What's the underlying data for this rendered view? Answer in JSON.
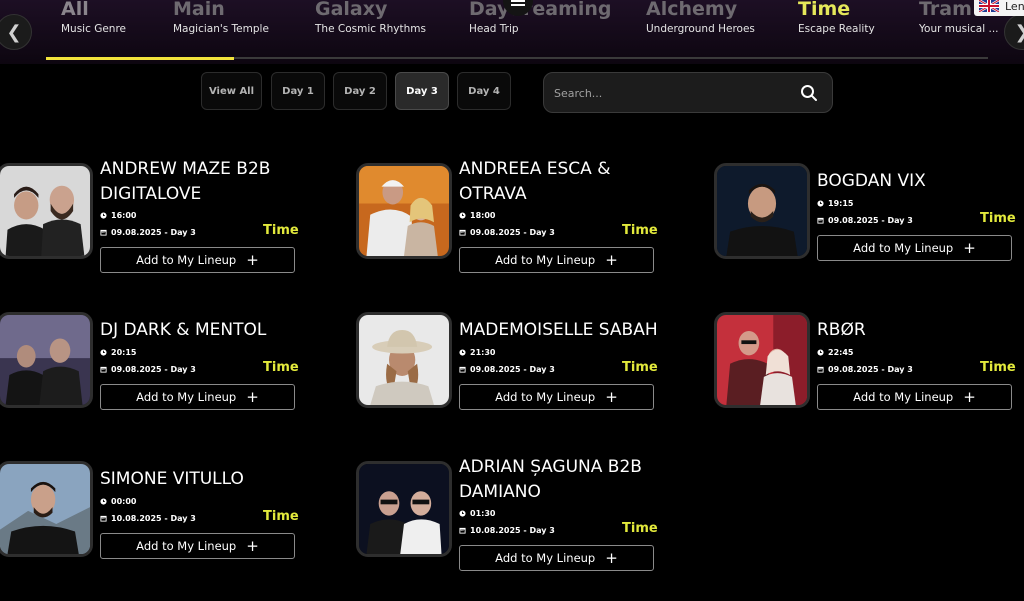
{
  "stages": [
    {
      "name": "All",
      "subtitle": "Music Genre"
    },
    {
      "name": "Main",
      "subtitle": "Magician's Temple"
    },
    {
      "name": "Galaxy",
      "subtitle": "The Cosmic Rhythms"
    },
    {
      "name": "Daydreaming",
      "subtitle": "Head Trip"
    },
    {
      "name": "Alchemy",
      "subtitle": "Underground Heroes"
    },
    {
      "name": "Time",
      "subtitle": "Escape Reality"
    },
    {
      "name": "Tram",
      "subtitle": "Your musical ..."
    }
  ],
  "nav": {
    "prev_icon": "chevron-left-icon",
    "next_icon": "chevron-right-icon",
    "menu_icon": "hamburger-menu-icon"
  },
  "language": {
    "label": "Len",
    "flag_icon": "uk-flag-icon"
  },
  "day_filters": [
    "View All",
    "Day 1",
    "Day 2",
    "Day 3",
    "Day 4"
  ],
  "active_day": "Day 3",
  "search": {
    "placeholder": "Search...",
    "value": "",
    "icon": "magnifier-icon"
  },
  "colors": {
    "accent": "#e3ea3c",
    "active_underline": "#f2e43c",
    "background": "#000000"
  },
  "lineup_button_label": "Add to My Lineup",
  "artists": [
    {
      "name": "ANDREW MAZE B2B DIGITALOVE",
      "time": "16:00",
      "date": "09.08.2025 - Day 3",
      "stage": "Time"
    },
    {
      "name": "ANDREEA ESCA & OTRAVA",
      "time": "18:00",
      "date": "09.08.2025 - Day 3",
      "stage": "Time"
    },
    {
      "name": "BOGDAN VIX",
      "time": "19:15",
      "date": "09.08.2025 - Day 3",
      "stage": "Time"
    },
    {
      "name": "DJ DARK & MENTOL",
      "time": "20:15",
      "date": "09.08.2025 - Day 3",
      "stage": "Time"
    },
    {
      "name": "MADEMOISELLE SABAH",
      "time": "21:30",
      "date": "09.08.2025 - Day 3",
      "stage": "Time"
    },
    {
      "name": "RBØR",
      "time": "22:45",
      "date": "09.08.2025 - Day 3",
      "stage": "Time"
    },
    {
      "name": "SIMONE VITULLO",
      "time": "00:00",
      "date": "10.08.2025 - Day 3",
      "stage": "Time"
    },
    {
      "name": "ADRIAN ȘAGUNA B2B DAMIANO",
      "time": "01:30",
      "date": "10.08.2025 - Day 3",
      "stage": "Time"
    }
  ]
}
